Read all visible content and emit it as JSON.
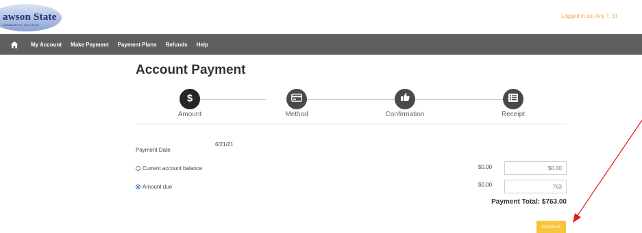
{
  "header": {
    "logo_text": "awson State",
    "logo_subtext": "COMMUNITY COLLEGE",
    "logged_in": "Logged in as: Any T. St"
  },
  "nav": {
    "items": [
      "My Account",
      "Make Payment",
      "Payment Plans",
      "Refunds",
      "Help"
    ]
  },
  "page": {
    "title": "Account Payment"
  },
  "steps": [
    {
      "label": "Amount",
      "icon": "dollar-icon",
      "active": true
    },
    {
      "label": "Method",
      "icon": "credit-card-icon",
      "active": false
    },
    {
      "label": "Confirmation",
      "icon": "thumbs-up-icon",
      "active": false
    },
    {
      "label": "Receipt",
      "icon": "list-icon",
      "active": false
    }
  ],
  "form": {
    "payment_date_label": "Payment Date",
    "payment_date_value": "6/21/21",
    "options": [
      {
        "label": "Current account balance",
        "balance": "$0.00",
        "input_value": "$0.00",
        "selected": false
      },
      {
        "label": "Amount due",
        "balance": "$0.00",
        "input_value": "763",
        "selected": true
      }
    ],
    "total": "Payment Total: $763.00",
    "continue_label": "Continue"
  },
  "annotation": {
    "arrow_color": "#e21b1b"
  },
  "colors": {
    "nav_bg": "#5f5f5f",
    "accent_orange": "#f0a93c",
    "button_yellow": "#f7c53a",
    "radio_blue": "#2f6fd8"
  }
}
